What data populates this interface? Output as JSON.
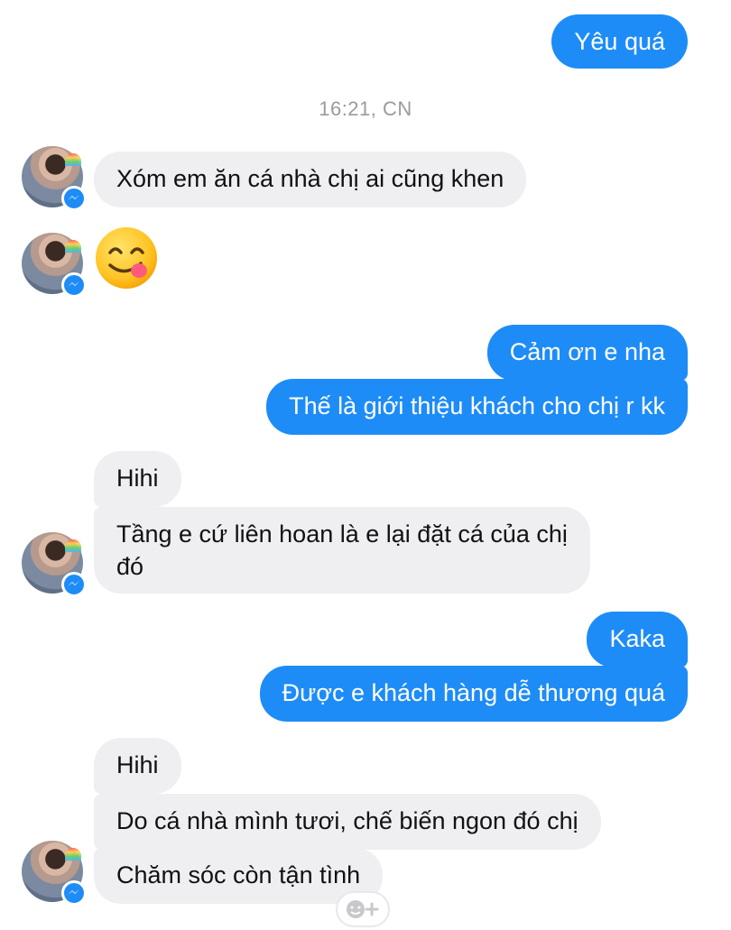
{
  "conversation": {
    "timestamp": "16:21, CN",
    "messages": [
      {
        "id": "m1",
        "side": "out",
        "text": "Yêu quá"
      },
      {
        "id": "m2",
        "side": "in",
        "text": "Xóm em ăn cá nhà chị ai cũng khen"
      },
      {
        "id": "m3",
        "side": "in",
        "emoji": "face-savoring-food-icon"
      },
      {
        "id": "m4",
        "side": "out",
        "text": "Cảm ơn e nha"
      },
      {
        "id": "m5",
        "side": "out",
        "text": "Thế là giới thiệu khách cho chị r kk"
      },
      {
        "id": "m6",
        "side": "in",
        "text": "Hihi"
      },
      {
        "id": "m7",
        "side": "in",
        "text_line1": "Tầng e cứ liên hoan là e lại đặt cá của chị",
        "text_line2": "đó"
      },
      {
        "id": "m8",
        "side": "out",
        "text": "Kaka"
      },
      {
        "id": "m9",
        "side": "out",
        "text": "Được e khách hàng dễ thương quá"
      },
      {
        "id": "m10",
        "side": "in",
        "text": "Hihi"
      },
      {
        "id": "m11",
        "side": "in",
        "text": "Do cá nhà mình tươi, chế biến ngon đó chị"
      },
      {
        "id": "m12",
        "side": "in",
        "text": "Chăm sóc còn tận tình"
      }
    ]
  },
  "colors": {
    "outgoing_bubble": "#1e8cf7",
    "incoming_bubble": "#efeff2",
    "timestamp_text": "#9a9aa0"
  },
  "icons": {
    "avatar_badge": "messenger-badge-icon",
    "reaction_button": "add-reaction-icon"
  }
}
